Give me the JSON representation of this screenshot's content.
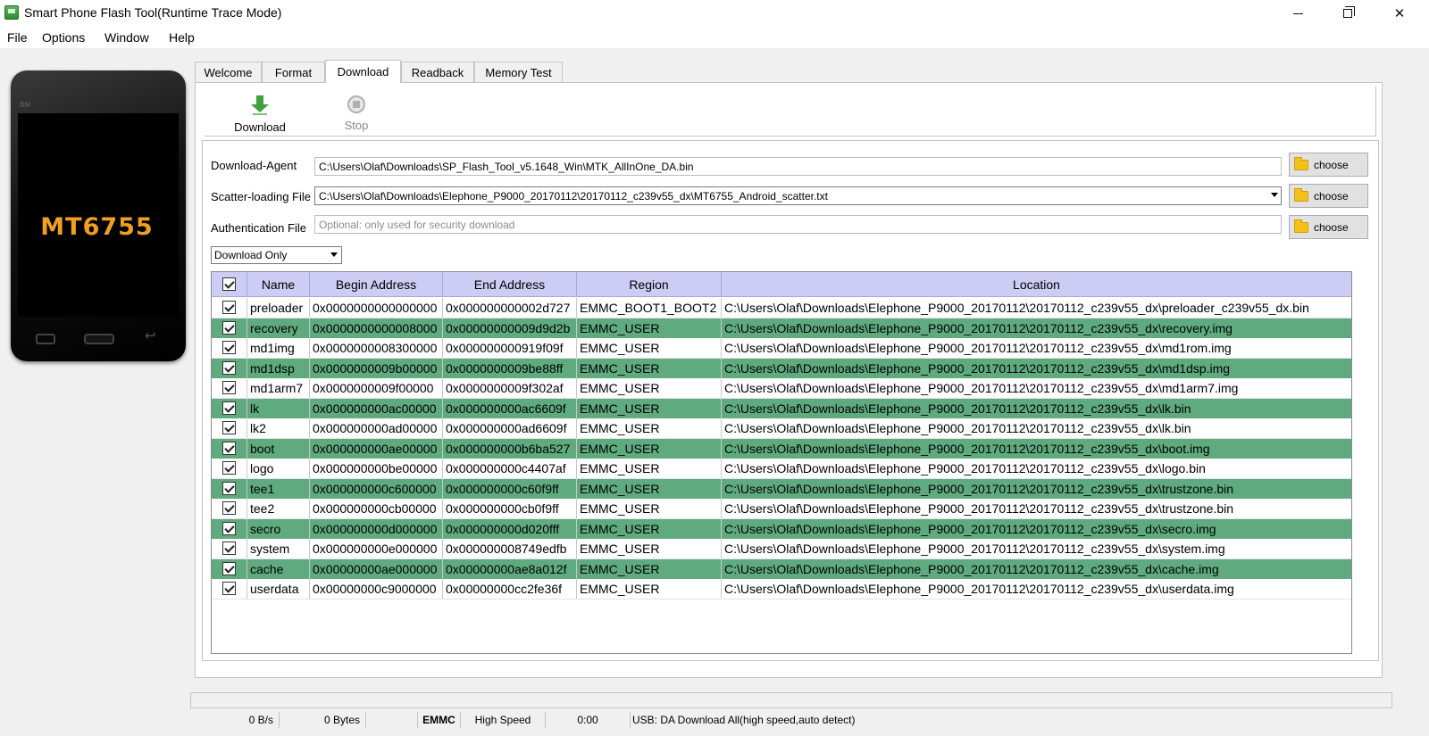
{
  "window": {
    "title": "Smart Phone Flash Tool(Runtime Trace Mode)",
    "minimize_glyph": "",
    "close_glyph": "✕"
  },
  "menu": [
    "File",
    "Options",
    "Window",
    "Help"
  ],
  "phone": {
    "brand": "BM",
    "model": "MT6755"
  },
  "tabs": [
    "Welcome",
    "Format",
    "Download",
    "Readback",
    "Memory Test"
  ],
  "active_tab": "Download",
  "toolbar": {
    "download_label": "Download",
    "stop_label": "Stop"
  },
  "form": {
    "download_agent_label": "Download-Agent",
    "download_agent_value": "C:\\Users\\Olaf\\Downloads\\SP_Flash_Tool_v5.1648_Win\\MTK_AllInOne_DA.bin",
    "scatter_label": "Scatter-loading File",
    "scatter_value": "C:\\Users\\Olaf\\Downloads\\Elephone_P9000_20170112\\20170112_c239v55_dx\\MT6755_Android_scatter.txt",
    "auth_label": "Authentication File",
    "auth_placeholder": "Optional: only used for security download",
    "choose_label": "choose",
    "mode_value": "Download Only"
  },
  "table": {
    "columns": [
      "Name",
      "Begin Address",
      "End Address",
      "Region",
      "Location"
    ],
    "rows": [
      {
        "name": "preloader",
        "begin": "0x0000000000000000",
        "end": "0x000000000002d727",
        "region": "EMMC_BOOT1_BOOT2",
        "location": "C:\\Users\\Olaf\\Downloads\\Elephone_P9000_20170112\\20170112_c239v55_dx\\preloader_c239v55_dx.bin",
        "checked": true
      },
      {
        "name": "recovery",
        "begin": "0x0000000000008000",
        "end": "0x00000000009d9d2b",
        "region": "EMMC_USER",
        "location": "C:\\Users\\Olaf\\Downloads\\Elephone_P9000_20170112\\20170112_c239v55_dx\\recovery.img",
        "checked": true
      },
      {
        "name": "md1img",
        "begin": "0x0000000008300000",
        "end": "0x000000000919f09f",
        "region": "EMMC_USER",
        "location": "C:\\Users\\Olaf\\Downloads\\Elephone_P9000_20170112\\20170112_c239v55_dx\\md1rom.img",
        "checked": true
      },
      {
        "name": "md1dsp",
        "begin": "0x0000000009b00000",
        "end": "0x0000000009be88ff",
        "region": "EMMC_USER",
        "location": "C:\\Users\\Olaf\\Downloads\\Elephone_P9000_20170112\\20170112_c239v55_dx\\md1dsp.img",
        "checked": true
      },
      {
        "name": "md1arm7",
        "begin": "0x0000000009f00000",
        "end": "0x0000000009f302af",
        "region": "EMMC_USER",
        "location": "C:\\Users\\Olaf\\Downloads\\Elephone_P9000_20170112\\20170112_c239v55_dx\\md1arm7.img",
        "checked": true
      },
      {
        "name": "lk",
        "begin": "0x000000000ac00000",
        "end": "0x000000000ac6609f",
        "region": "EMMC_USER",
        "location": "C:\\Users\\Olaf\\Downloads\\Elephone_P9000_20170112\\20170112_c239v55_dx\\lk.bin",
        "checked": true
      },
      {
        "name": "lk2",
        "begin": "0x000000000ad00000",
        "end": "0x000000000ad6609f",
        "region": "EMMC_USER",
        "location": "C:\\Users\\Olaf\\Downloads\\Elephone_P9000_20170112\\20170112_c239v55_dx\\lk.bin",
        "checked": true
      },
      {
        "name": "boot",
        "begin": "0x000000000ae00000",
        "end": "0x000000000b6ba527",
        "region": "EMMC_USER",
        "location": "C:\\Users\\Olaf\\Downloads\\Elephone_P9000_20170112\\20170112_c239v55_dx\\boot.img",
        "checked": true
      },
      {
        "name": "logo",
        "begin": "0x000000000be00000",
        "end": "0x000000000c4407af",
        "region": "EMMC_USER",
        "location": "C:\\Users\\Olaf\\Downloads\\Elephone_P9000_20170112\\20170112_c239v55_dx\\logo.bin",
        "checked": true
      },
      {
        "name": "tee1",
        "begin": "0x000000000c600000",
        "end": "0x000000000c60f9ff",
        "region": "EMMC_USER",
        "location": "C:\\Users\\Olaf\\Downloads\\Elephone_P9000_20170112\\20170112_c239v55_dx\\trustzone.bin",
        "checked": true
      },
      {
        "name": "tee2",
        "begin": "0x000000000cb00000",
        "end": "0x000000000cb0f9ff",
        "region": "EMMC_USER",
        "location": "C:\\Users\\Olaf\\Downloads\\Elephone_P9000_20170112\\20170112_c239v55_dx\\trustzone.bin",
        "checked": true
      },
      {
        "name": "secro",
        "begin": "0x000000000d000000",
        "end": "0x000000000d020fff",
        "region": "EMMC_USER",
        "location": "C:\\Users\\Olaf\\Downloads\\Elephone_P9000_20170112\\20170112_c239v55_dx\\secro.img",
        "checked": true
      },
      {
        "name": "system",
        "begin": "0x000000000e000000",
        "end": "0x000000008749edfb",
        "region": "EMMC_USER",
        "location": "C:\\Users\\Olaf\\Downloads\\Elephone_P9000_20170112\\20170112_c239v55_dx\\system.img",
        "checked": true
      },
      {
        "name": "cache",
        "begin": "0x00000000ae000000",
        "end": "0x00000000ae8a012f",
        "region": "EMMC_USER",
        "location": "C:\\Users\\Olaf\\Downloads\\Elephone_P9000_20170112\\20170112_c239v55_dx\\cache.img",
        "checked": true
      },
      {
        "name": "userdata",
        "begin": "0x00000000c9000000",
        "end": "0x00000000cc2fe36f",
        "region": "EMMC_USER",
        "location": "C:\\Users\\Olaf\\Downloads\\Elephone_P9000_20170112\\20170112_c239v55_dx\\userdata.img",
        "checked": true
      }
    ]
  },
  "status": {
    "speed": "0 B/s",
    "bytes": "0 Bytes",
    "storage": "EMMC",
    "mode": "High Speed",
    "time": "0:00",
    "usb": "USB: DA Download All(high speed,auto detect)"
  },
  "colors": {
    "row_highlight": "#5fab7f",
    "header_bg": "#ccccf5",
    "phone_model": "#f0a020"
  }
}
